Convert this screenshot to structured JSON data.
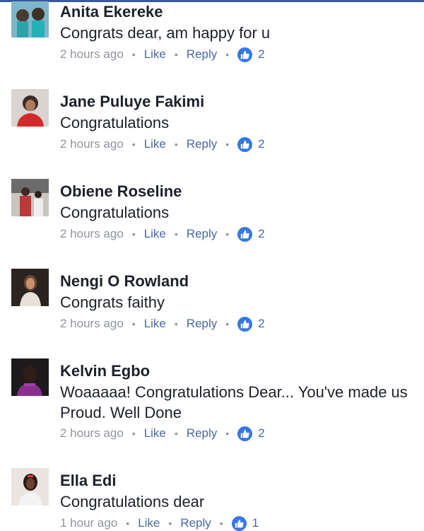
{
  "comments": [
    {
      "name": "Anita Ekereke",
      "text": "Congrats dear, am happy for u",
      "time": "2 hours ago",
      "like": "Like",
      "reply": "Reply",
      "likes": "2"
    },
    {
      "name": "Jane Puluye Fakimi",
      "text": "Congratulations",
      "time": "2 hours ago",
      "like": "Like",
      "reply": "Reply",
      "likes": "2"
    },
    {
      "name": "Obiene Roseline",
      "text": "Congratulations",
      "time": "2 hours ago",
      "like": "Like",
      "reply": "Reply",
      "likes": "2"
    },
    {
      "name": "Nengi O Rowland",
      "text": "Congrats faithy",
      "time": "2 hours ago",
      "like": "Like",
      "reply": "Reply",
      "likes": "2"
    },
    {
      "name": "Kelvin Egbo",
      "text": "Woaaaaa! Congratulations Dear... You've made us Proud. Well Done",
      "time": "2 hours ago",
      "like": "Like",
      "reply": "Reply",
      "likes": "2"
    },
    {
      "name": "Ella Edi",
      "text": "Congratulations dear",
      "time": "1 hour ago",
      "like": "Like",
      "reply": "Reply",
      "likes": "1"
    }
  ],
  "colors": {
    "accent": "#3b5998",
    "like_badge": "#3578e5",
    "link": "#4b67a1",
    "muted": "#90949c"
  },
  "icons": {
    "like_badge": "thumbs-up-icon",
    "avatar": "avatar-photo"
  }
}
